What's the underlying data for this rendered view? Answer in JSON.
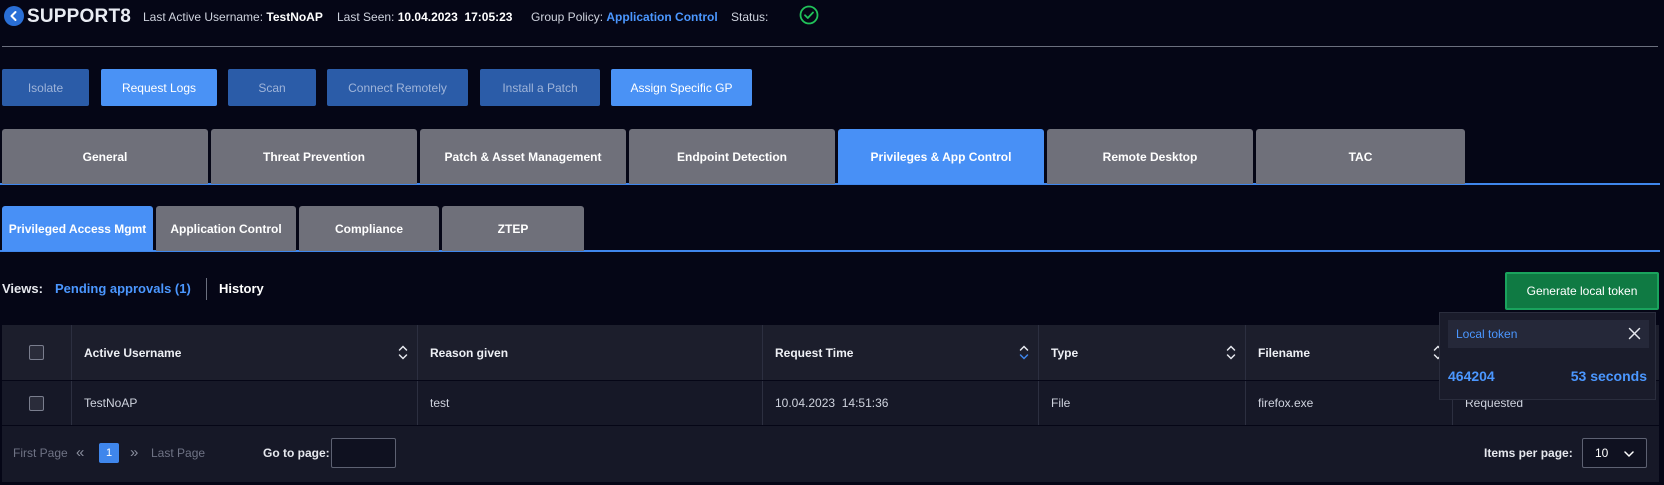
{
  "header": {
    "device_name": "SUPPORT8",
    "last_active_label": "Last Active Username:",
    "last_active_value": "TestNoAP",
    "last_seen_label": "Last Seen:",
    "last_seen_value": "10.04.2023  17:05:23",
    "group_policy_label": "Group Policy:",
    "group_policy_value": "Application Control",
    "status_label": "Status:",
    "status_icon": "check-circle-icon"
  },
  "actions": {
    "isolate": "Isolate",
    "request_logs": "Request Logs",
    "scan": "Scan",
    "connect_remotely": "Connect Remotely",
    "install_patch": "Install a Patch",
    "assign_gp": "Assign Specific GP"
  },
  "main_tabs": [
    {
      "label": "General"
    },
    {
      "label": "Threat Prevention"
    },
    {
      "label": "Patch & Asset Management"
    },
    {
      "label": "Endpoint Detection"
    },
    {
      "label": "Privileges & App Control",
      "active": true
    },
    {
      "label": "Remote Desktop"
    },
    {
      "label": "TAC"
    }
  ],
  "sub_tabs": [
    {
      "label": "Privileged Access Mgmt",
      "active": true
    },
    {
      "label": "Application Control"
    },
    {
      "label": "Compliance"
    },
    {
      "label": "ZTEP"
    }
  ],
  "views": {
    "label": "Views:",
    "pending": "Pending approvals (1)",
    "history": "History"
  },
  "generate_token_label": "Generate local token",
  "table": {
    "columns": [
      "Active Username",
      "Reason given",
      "Request Time",
      "Type",
      "Filename"
    ],
    "rows": [
      {
        "username": "TestNoAP",
        "reason": "test",
        "request_time": "10.04.2023  14:51:36",
        "type": "File",
        "filename": "firefox.exe",
        "status": "Requested"
      }
    ]
  },
  "pagination": {
    "first_page": "First Page",
    "last_page": "Last Page",
    "current_page": "1",
    "goto_label": "Go to page:",
    "goto_value": "",
    "items_per_page_label": "Items per page:",
    "items_per_page_value": "10"
  },
  "local_token": {
    "title": "Local token",
    "code": "464204",
    "expires": "53 seconds"
  },
  "colors": {
    "accent": "#4890f6",
    "link": "#4b97ff",
    "success": "#1aa35d",
    "background": "#050616"
  }
}
